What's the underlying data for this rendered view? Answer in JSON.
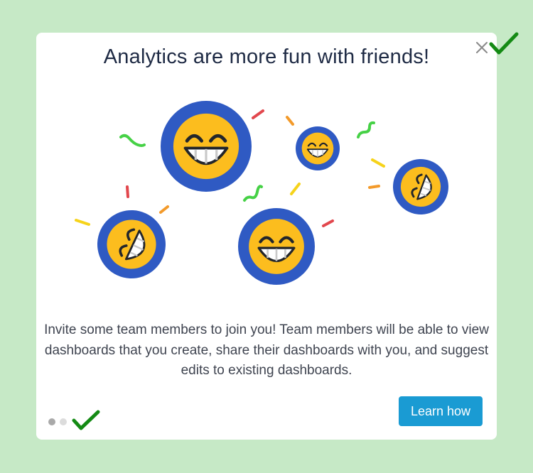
{
  "dialog": {
    "title": "Analytics are more fun with friends!",
    "body": "Invite some team members to join you! Team members will be able to view dashboards that you create, share their dashboards with you, and suggest edits to existing dashboards.",
    "learn_more_label": "Learn how",
    "pagination": {
      "current_page": 1,
      "total_pages": 2
    }
  },
  "icons": {
    "close": "close-icon",
    "checkmark": "checkmark-icon",
    "emoji": "grinning-face-icon",
    "confetti": "confetti-icon"
  },
  "colors": {
    "page_background": "#c6e9c6",
    "dialog_background": "#ffffff",
    "button": "#1a9bd3",
    "emoji_ring": "#2f5ac3",
    "emoji_face": "#fcbd1e",
    "checkmark": "#148a14"
  }
}
